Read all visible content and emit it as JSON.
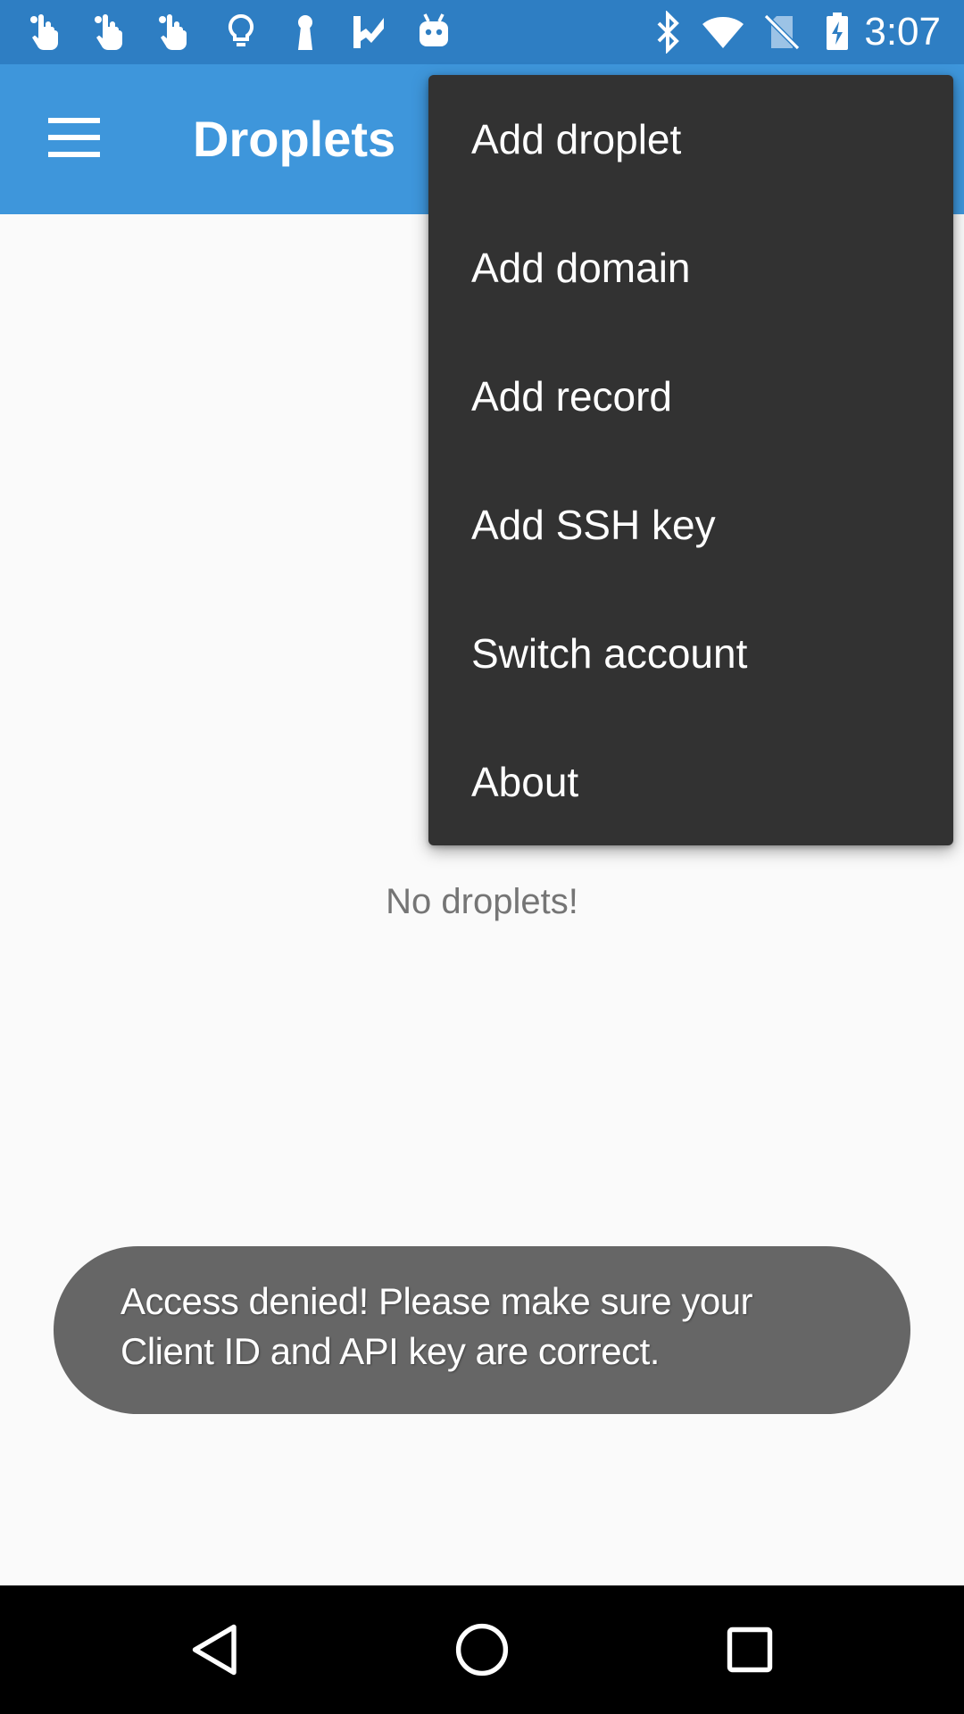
{
  "status_bar": {
    "time": "3:07",
    "left_icons": [
      "hand-pointer-icon",
      "hand-pointer-icon",
      "hand-pointer-icon",
      "lightbulb-icon",
      "keyhole-icon",
      "checkmark-flag-icon",
      "android-robot-icon"
    ],
    "right_icons": [
      "bluetooth-icon",
      "wifi-icon",
      "no-sim-icon",
      "battery-charging-icon"
    ],
    "background_color": "#2e7ec3"
  },
  "app_bar": {
    "title": "Droplets",
    "background_color": "#3e96db"
  },
  "main": {
    "empty_message": "No droplets!"
  },
  "overflow_menu": {
    "items": [
      {
        "label": "Add droplet"
      },
      {
        "label": "Add domain"
      },
      {
        "label": "Add record"
      },
      {
        "label": "Add SSH key"
      },
      {
        "label": "Switch account"
      },
      {
        "label": "About"
      }
    ],
    "background_color": "#323232"
  },
  "toast": {
    "line1": "Access denied! Please make sure your",
    "line2": "Client ID and API key are correct."
  },
  "nav_bar": {
    "buttons": [
      "back-icon",
      "home-icon",
      "recents-icon"
    ]
  }
}
